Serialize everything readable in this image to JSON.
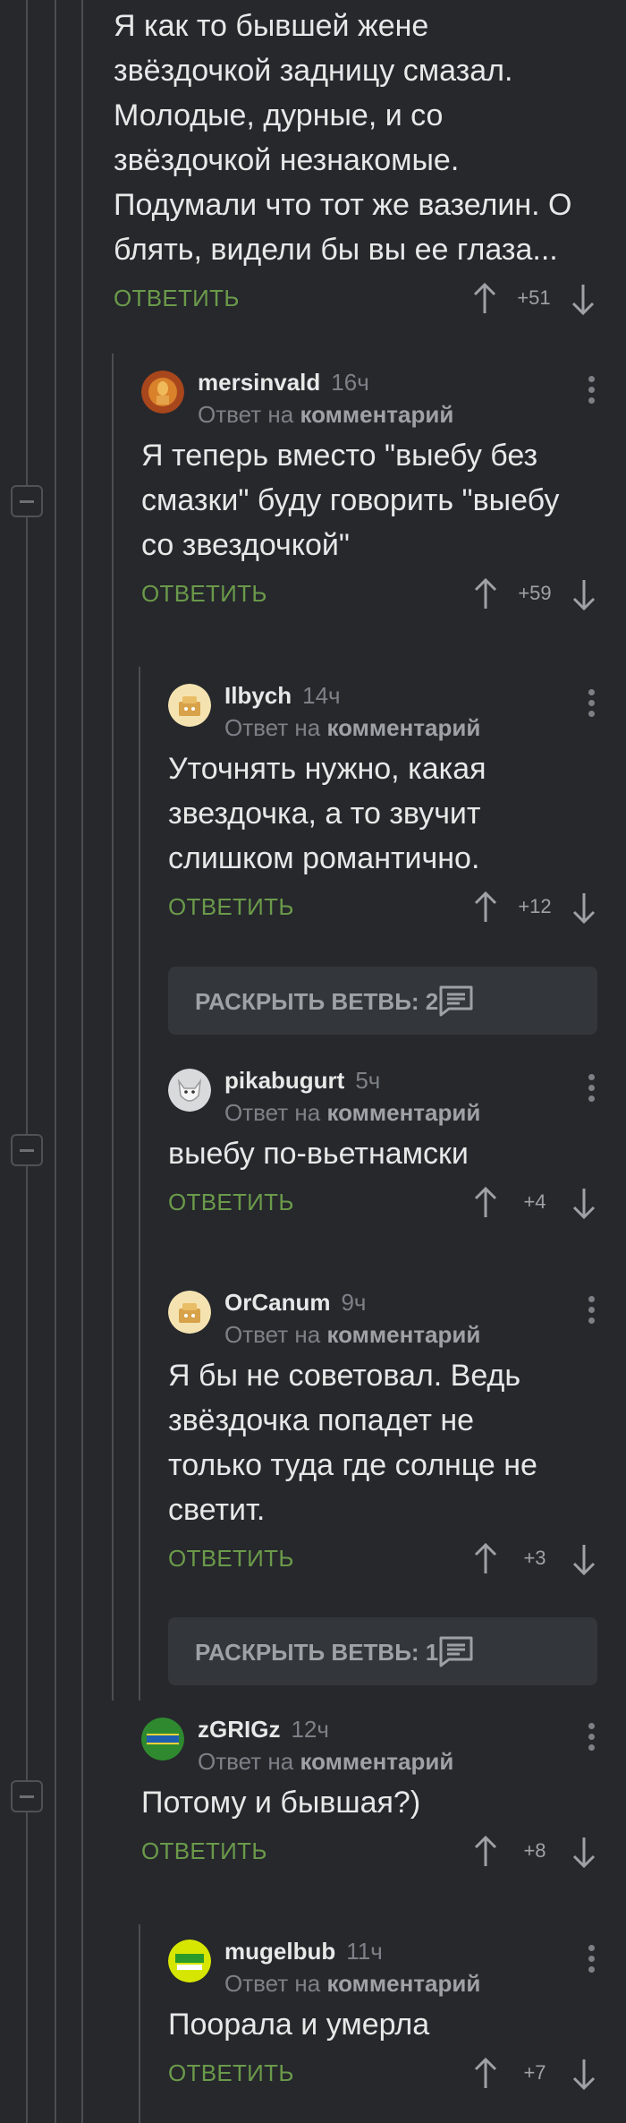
{
  "colors": {
    "background": "#26282c",
    "reply_green": "#6b9a4a",
    "muted": "#7d8187",
    "thread_line": "#4a4d52"
  },
  "top_comment": {
    "text_lines": [
      "Я как то бывшей жене",
      "звёздочкой задницу смазал.",
      "Молодые, дурные, и со",
      "звёздочкой незнакомые.",
      "Подумали что тот же вазелин. О",
      "блять, видели бы вы ее глаза..."
    ],
    "reply_label": "ОТВЕТИТЬ",
    "score": "+51"
  },
  "comments": [
    {
      "username": "mersinvald",
      "time": "16ч",
      "reply_prefix": "Ответ на",
      "reply_target": "комментарий",
      "text_lines": [
        "Я теперь вместо \"выебу без",
        "смазки\" буду говорить \"выебу",
        "со звездочкой\""
      ],
      "reply_label": "ОТВЕТИТЬ",
      "score": "+59",
      "avatar": "user-avatar-icon"
    },
    {
      "username": "Ilbych",
      "time": "14ч",
      "reply_prefix": "Ответ на",
      "reply_target": "комментарий",
      "text_lines": [
        "Уточнять нужно, какая",
        "звездочка, а то звучит",
        "слишком романтично."
      ],
      "reply_label": "ОТВЕТИТЬ",
      "score": "+12",
      "expand_label": "РАСКРЫТЬ ВЕТВЬ: 2",
      "avatar": "default-avatar-icon"
    },
    {
      "username": "pikabugurt",
      "time": "5ч",
      "reply_prefix": "Ответ на",
      "reply_target": "комментарий",
      "text_lines": [
        "выебу по-вьетнамски"
      ],
      "reply_label": "ОТВЕТИТЬ",
      "score": "+4",
      "avatar": "dog-avatar-icon"
    },
    {
      "username": "OrCanum",
      "time": "9ч",
      "reply_prefix": "Ответ на",
      "reply_target": "комментарий",
      "text_lines": [
        "Я бы не советовал. Ведь",
        "звёздочка попадет не",
        "только туда где солнце не",
        "светит."
      ],
      "reply_label": "ОТВЕТИТЬ",
      "score": "+3",
      "expand_label": "РАСКРЫТЬ ВЕТВЬ: 1",
      "avatar": "default-avatar-icon"
    },
    {
      "username": "zGRIGz",
      "time": "12ч",
      "reply_prefix": "Ответ на",
      "reply_target": "комментарий",
      "text_lines": [
        "Потому и бывшая?)"
      ],
      "reply_label": "ОТВЕТИТЬ",
      "score": "+8",
      "avatar": "user-avatar-icon"
    },
    {
      "username": "mugelbub",
      "time": "11ч",
      "reply_prefix": "Ответ на",
      "reply_target": "комментарий",
      "text_lines": [
        "Поорала и умерла"
      ],
      "reply_label": "ОТВЕТИТЬ",
      "score": "+7",
      "avatar": "user-avatar-icon"
    }
  ]
}
